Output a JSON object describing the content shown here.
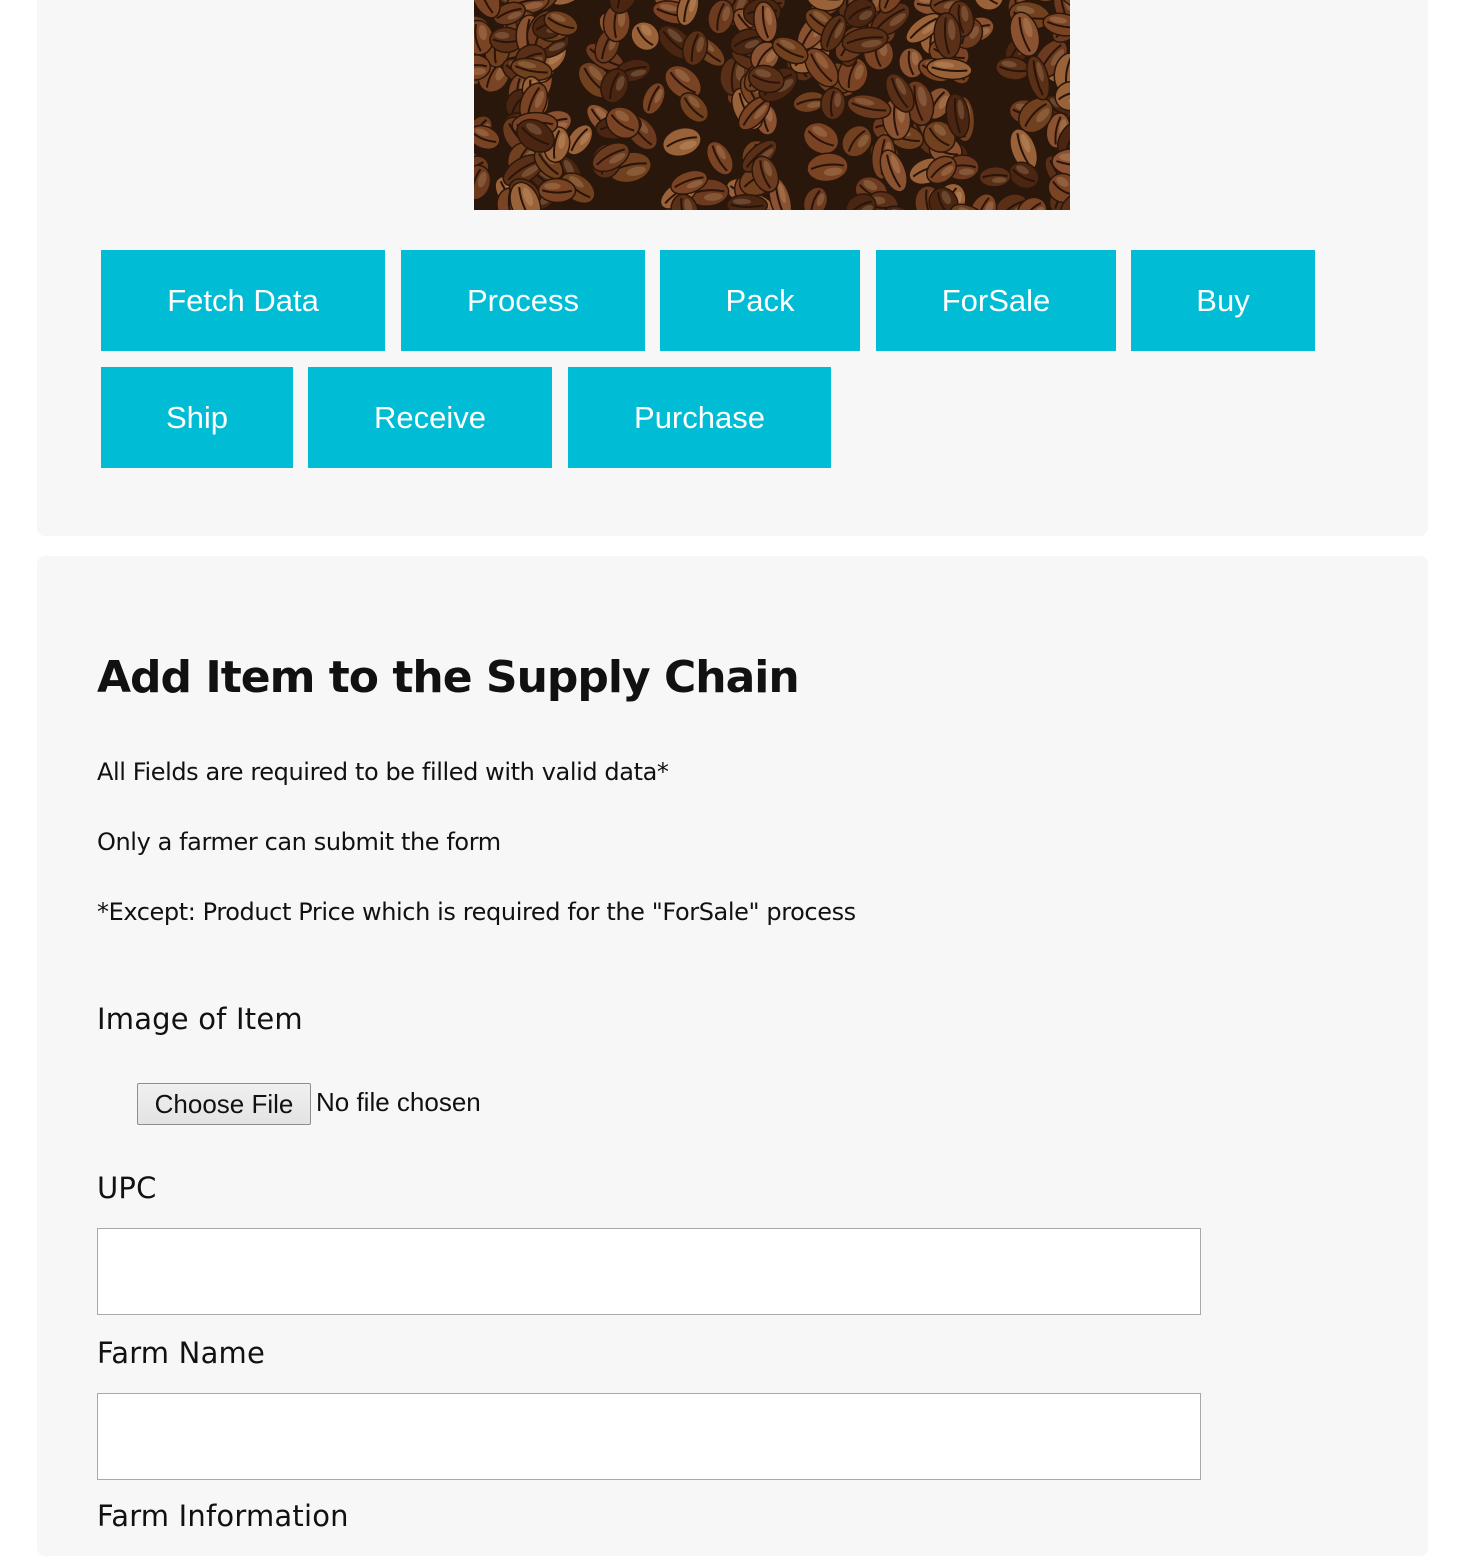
{
  "hero_image": {
    "alt": "coffee beans"
  },
  "actions": {
    "fetch_data": "Fetch Data",
    "process": "Process",
    "pack": "Pack",
    "for_sale": "ForSale",
    "buy": "Buy",
    "ship": "Ship",
    "receive": "Receive",
    "purchase": "Purchase"
  },
  "accent_color": "#00bcd4",
  "form": {
    "title": "Add Item to the Supply Chain",
    "notes": [
      "All Fields are required to be filled with valid data*",
      "Only a farmer can submit the form",
      "*Except: Product Price which is required for the \"ForSale\" process"
    ],
    "image_label": "Image of Item",
    "file_button": "Choose File",
    "file_status": "No file chosen",
    "upc_label": "UPC",
    "upc_value": "",
    "farm_name_label": "Farm Name",
    "farm_name_value": "",
    "farm_info_label": "Farm Information"
  }
}
